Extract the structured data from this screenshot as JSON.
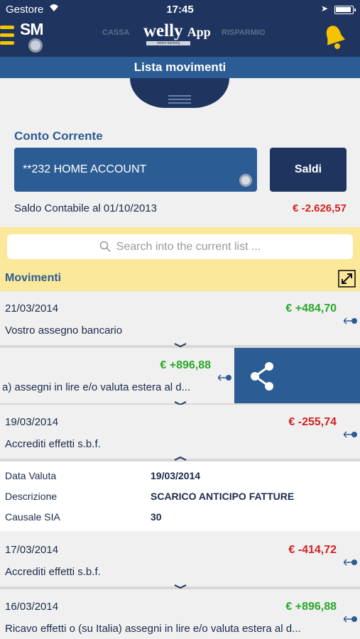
{
  "status_bar": {
    "carrier": "Gestore",
    "time": "17:45"
  },
  "header": {
    "brand_short": "SM",
    "logo_main": "welly",
    "logo_app": "App",
    "logo_tagline": "online banking",
    "logo_ghost_left": "CASSA",
    "logo_ghost_right": "RISPARMIO"
  },
  "page_title": "Lista movimenti",
  "account": {
    "label": "Conto Corrente",
    "selected": "**232 HOME ACCOUNT",
    "saldi_button": "Saldi",
    "saldo_label": "Saldo Contabile al 01/10/2013",
    "saldo_value": "€ -2.626,57"
  },
  "search": {
    "placeholder": "Search into the current list ..."
  },
  "movimenti_title": "Movimenti",
  "movements": [
    {
      "date": "21/03/2014",
      "amount": "€ +484,70",
      "sign": "pos",
      "description": "Vostro assegno bancario"
    },
    {
      "date": "",
      "amount": "€ +896,88",
      "sign": "pos",
      "description": "a) assegni in lire e/o valuta estera al d..."
    },
    {
      "date": "19/03/2014",
      "amount": "€ -255,74",
      "sign": "neg",
      "description": "Accrediti effetti s.b.f."
    },
    {
      "date": "17/03/2014",
      "amount": "€ -414,72",
      "sign": "neg",
      "description": "Accrediti effetti s.b.f."
    },
    {
      "date": "16/03/2014",
      "amount": "€ +896,88",
      "sign": "pos",
      "description": "Ricavo effetti o (su Italia) assegni in lire e/o valuta estera al d..."
    }
  ],
  "detail": {
    "data_valuta_label": "Data Valuta",
    "data_valuta": "19/03/2014",
    "descrizione_label": "Descrizione",
    "descrizione": "SCARICO ANTICIPO FATTURE",
    "causale_label": "Causale SIA",
    "causale": "30"
  },
  "icons": {
    "menu": "hamburger-menu-icon",
    "bell": "bell-icon",
    "search": "search-icon",
    "expand": "expand-arrows-icon",
    "share": "share-icon",
    "row_arrow": "arrow-right-icon"
  },
  "colors": {
    "navy": "#1f3560",
    "blue": "#2c5c94",
    "yellow": "#fce89a",
    "positive": "#2aa82a",
    "negative": "#d32121"
  }
}
